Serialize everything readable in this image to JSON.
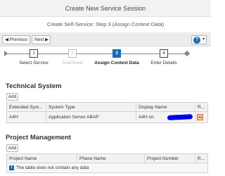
{
  "window": {
    "title": "Create New Service Session"
  },
  "subtitle": "Create Self-Service: Step 3  (Assign Context Data)",
  "toolbar": {
    "previous_label": "◀ Previous",
    "next_label": "Next ▶",
    "help_icon": "help-icon"
  },
  "roadmap": {
    "steps": [
      {
        "number": "1",
        "label": "Select Service",
        "state": "done"
      },
      {
        "number": "2",
        "label": "Download",
        "state": "disabled"
      },
      {
        "number": "3",
        "label": "Assign Context Data",
        "state": "active"
      },
      {
        "number": "4",
        "label": "Enter Details",
        "state": "pending"
      }
    ]
  },
  "technical_system": {
    "title": "Technical System",
    "add_label": "Add",
    "columns": [
      "Extended Syst...",
      "System Type",
      "Display Name",
      "R..."
    ],
    "rows": [
      {
        "extended_system": "A4H",
        "system_type": "Application Server ABAP",
        "display_name": "A4H on"
      }
    ]
  },
  "project_management": {
    "title": "Project Management",
    "add_label": "Add",
    "columns": [
      "Project Name",
      "Phase Name",
      "Project Number",
      "R..."
    ],
    "empty_text": "The table does not contain any data"
  },
  "colors": {
    "accent": "#1b6ab5",
    "redaction": "#0000ee"
  }
}
